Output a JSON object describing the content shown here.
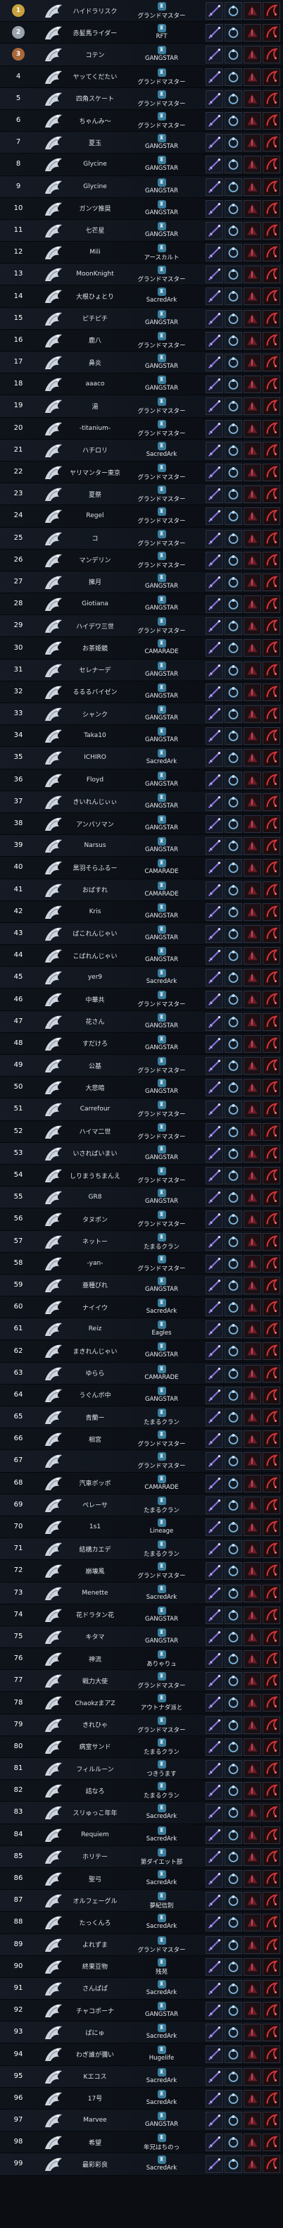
{
  "colors": {
    "gold": "#c7a13c",
    "silver": "#9aa3ad",
    "bronze": "#a9683a",
    "rank_blue": "#3f8fd8",
    "guild_icon": "#3b7c9b"
  },
  "icons": {
    "class": "class-emblem-icon",
    "guild": "guild-emblem-icon",
    "weapon": "weapon-icon",
    "ring": "ring-icon",
    "relic": "relic-icon",
    "accessory": "accessory-icon"
  },
  "players": [
    {
      "rank": "1",
      "name": "ハイドラリスク",
      "guild": "グランドマスター"
    },
    {
      "rank": "2",
      "name": "赤髪馬ライダー",
      "guild": "RFT"
    },
    {
      "rank": "3",
      "name": "コテン",
      "guild": "GANGSTAR"
    },
    {
      "rank": "4",
      "name": "ヤッてくだたい",
      "guild": "グランドマスター"
    },
    {
      "rank": "5",
      "name": "四角スケート",
      "guild": "グランドマスター"
    },
    {
      "rank": "6",
      "name": "ちゃんみ〜",
      "guild": "グランドマスター"
    },
    {
      "rank": "7",
      "name": "夏玉",
      "guild": "GANGSTAR"
    },
    {
      "rank": "8",
      "name": "Glycine",
      "guild": "GANGSTAR"
    },
    {
      "rank": "9",
      "name": "Glycine",
      "guild": "GANGSTAR"
    },
    {
      "rank": "10",
      "name": "ガンツ推奨",
      "guild": "GANGSTAR"
    },
    {
      "rank": "11",
      "name": "七芒星",
      "guild": "GANGSTAR"
    },
    {
      "rank": "12",
      "name": "Mili",
      "guild": "アースカルト"
    },
    {
      "rank": "13",
      "name": "MoonKnight",
      "guild": "グランドマスター"
    },
    {
      "rank": "14",
      "name": "大根ひょとり",
      "guild": "SacredArk"
    },
    {
      "rank": "15",
      "name": "ピチピチ",
      "guild": "GANGSTAR"
    },
    {
      "rank": "16",
      "name": "鹿八",
      "guild": "グランドマスター"
    },
    {
      "rank": "17",
      "name": "鼻炎",
      "guild": "GANGSTAR"
    },
    {
      "rank": "18",
      "name": "aaaco",
      "guild": "GANGSTAR"
    },
    {
      "rank": "19",
      "name": "湯",
      "guild": "グランドマスター"
    },
    {
      "rank": "20",
      "name": "-titanium-",
      "guild": "グランドマスター"
    },
    {
      "rank": "21",
      "name": "ハチロリ",
      "guild": "SacredArk"
    },
    {
      "rank": "22",
      "name": "ヤリマンター東京",
      "guild": "グランドマスター"
    },
    {
      "rank": "23",
      "name": "夏祭",
      "guild": "グランドマスター"
    },
    {
      "rank": "24",
      "name": "Regel",
      "guild": "グランドマスター"
    },
    {
      "rank": "25",
      "name": "コ",
      "guild": "グランドマスター"
    },
    {
      "rank": "26",
      "name": "マンデリン",
      "guild": "グランドマスター"
    },
    {
      "rank": "27",
      "name": "擁月",
      "guild": "GANGSTAR"
    },
    {
      "rank": "28",
      "name": "Giotiana",
      "guild": "GANGSTAR"
    },
    {
      "rank": "29",
      "name": "ハイデワ三世",
      "guild": "グランドマスター"
    },
    {
      "rank": "30",
      "name": "お茶姫鏡",
      "guild": "CAMARADE"
    },
    {
      "rank": "31",
      "name": "セレナーデ",
      "guild": "GANGSTAR"
    },
    {
      "rank": "32",
      "name": "るるるバイゼン",
      "guild": "GANGSTAR"
    },
    {
      "rank": "33",
      "name": "シャンク",
      "guild": "GANGSTAR"
    },
    {
      "rank": "34",
      "name": "Taka10",
      "guild": "GANGSTAR"
    },
    {
      "rank": "35",
      "name": "ICHIRO",
      "guild": "SacredArk"
    },
    {
      "rank": "36",
      "name": "Floyd",
      "guild": "GANGSTAR"
    },
    {
      "rank": "37",
      "name": "きいれんじぃぃ",
      "guild": "GANGSTAR"
    },
    {
      "rank": "38",
      "name": "アンバソマン",
      "guild": "GANGSTAR"
    },
    {
      "rank": "39",
      "name": "Narsus",
      "guild": "GANGSTAR"
    },
    {
      "rank": "40",
      "name": "黒羽そらふるー",
      "guild": "CAMARADE"
    },
    {
      "rank": "41",
      "name": "おばすれ",
      "guild": "CAMARADE"
    },
    {
      "rank": "42",
      "name": "Kris",
      "guild": "GANGSTAR"
    },
    {
      "rank": "43",
      "name": "ばこれんじゃい",
      "guild": "GANGSTAR"
    },
    {
      "rank": "44",
      "name": "こばれんじゃい",
      "guild": "GANGSTAR"
    },
    {
      "rank": "45",
      "name": "yer9",
      "guild": "SacredArk"
    },
    {
      "rank": "46",
      "name": "中華共",
      "guild": "グランドマスター"
    },
    {
      "rank": "47",
      "name": "花さん",
      "guild": "GANGSTAR"
    },
    {
      "rank": "48",
      "name": "すだけろ",
      "guild": "GANGSTAR"
    },
    {
      "rank": "49",
      "name": "公基",
      "guild": "グランドマスター"
    },
    {
      "rank": "50",
      "name": "大悲暗",
      "guild": "GANGSTAR"
    },
    {
      "rank": "51",
      "name": "Carrefour",
      "guild": "グランドマスター"
    },
    {
      "rank": "52",
      "name": "ハイマ二世",
      "guild": "グランドマスター"
    },
    {
      "rank": "53",
      "name": "いさればいまい",
      "guild": "GANGSTAR"
    },
    {
      "rank": "54",
      "name": "しりまうちまんえ",
      "guild": "グランドマスター"
    },
    {
      "rank": "55",
      "name": "GR8",
      "guild": "GANGSTAR"
    },
    {
      "rank": "56",
      "name": "タヌポン",
      "guild": "グランドマスター"
    },
    {
      "rank": "57",
      "name": "ネットー",
      "guild": "たまるクラン"
    },
    {
      "rank": "58",
      "name": "-yan-",
      "guild": "グランドマスター"
    },
    {
      "rank": "59",
      "name": "亜種びれ",
      "guild": "GANGSTAR"
    },
    {
      "rank": "60",
      "name": "ナイイウ",
      "guild": "SacredArk"
    },
    {
      "rank": "61",
      "name": "Reiz",
      "guild": "Eagles"
    },
    {
      "rank": "62",
      "name": "まきれんじゃい",
      "guild": "GANGSTAR"
    },
    {
      "rank": "63",
      "name": "ゆらら",
      "guild": "CAMARADE"
    },
    {
      "rank": "64",
      "name": "うぐんボ中",
      "guild": "GANGSTAR"
    },
    {
      "rank": "65",
      "name": "青蘭ー",
      "guild": "たまるクラン"
    },
    {
      "rank": "66",
      "name": "相宮",
      "guild": "グランドマスター"
    },
    {
      "rank": "67",
      "name": "",
      "guild": "グランドマスター"
    },
    {
      "rank": "68",
      "name": "汽車ボッボ",
      "guild": "CAMARADE"
    },
    {
      "rank": "69",
      "name": "ペレーサ",
      "guild": "たまるクラン"
    },
    {
      "rank": "70",
      "name": "1s1",
      "guild": "Lineage"
    },
    {
      "rank": "71",
      "name": "結構カエデ",
      "guild": "たまるクラン"
    },
    {
      "rank": "72",
      "name": "崩壊風",
      "guild": "グランドマスター"
    },
    {
      "rank": "73",
      "name": "Menette",
      "guild": "SacredArk"
    },
    {
      "rank": "74",
      "name": "花ドラタン花",
      "guild": "GANGSTAR"
    },
    {
      "rank": "75",
      "name": "キタマ",
      "guild": "GANGSTAR"
    },
    {
      "rank": "76",
      "name": "神流",
      "guild": "ありゃりュ"
    },
    {
      "rank": "77",
      "name": "戦力大使",
      "guild": "グランドマスター"
    },
    {
      "rank": "78",
      "name": "ChaokzまアZ",
      "guild": "アウトナダ派と"
    },
    {
      "rank": "79",
      "name": "きれひゃ",
      "guild": "グランドマスター"
    },
    {
      "rank": "80",
      "name": "病室サンド",
      "guild": "たまるクラン"
    },
    {
      "rank": "81",
      "name": "フィルルーン",
      "guild": "つきうます"
    },
    {
      "rank": "82",
      "name": "詰なろ",
      "guild": "たまるクラン"
    },
    {
      "rank": "83",
      "name": "スリゅっこ年年",
      "guild": "SacredArk"
    },
    {
      "rank": "84",
      "name": "Requiem",
      "guild": "SacredArk"
    },
    {
      "rank": "85",
      "name": "ホリテー",
      "guild": "第ダイエット部"
    },
    {
      "rank": "86",
      "name": "聖弓",
      "guild": "SacredArk"
    },
    {
      "rank": "87",
      "name": "オルフェーグル",
      "guild": "夢紀信則"
    },
    {
      "rank": "88",
      "name": "たっくんろ",
      "guild": "SacredArk"
    },
    {
      "rank": "89",
      "name": "よれずま",
      "guild": "グランドマスター"
    },
    {
      "rank": "90",
      "name": "終果豆物",
      "guild": "残苑"
    },
    {
      "rank": "91",
      "name": "さんぱぱ",
      "guild": "SacredArk"
    },
    {
      "rank": "92",
      "name": "チャコポーナ",
      "guild": "GANGSTAR"
    },
    {
      "rank": "93",
      "name": "ぱにゅ",
      "guild": "SacredArk"
    },
    {
      "rank": "94",
      "name": "わぎ誰が彌い",
      "guild": "HugeIife"
    },
    {
      "rank": "95",
      "name": "Kエコス",
      "guild": "SacredArk"
    },
    {
      "rank": "96",
      "name": "17号",
      "guild": "SacredArk"
    },
    {
      "rank": "97",
      "name": "Marvee",
      "guild": "GANGSTAR"
    },
    {
      "rank": "98",
      "name": "希望",
      "guild": "年兄はちのっ"
    },
    {
      "rank": "99",
      "name": "最彩彩良",
      "guild": "SacredArk"
    }
  ]
}
